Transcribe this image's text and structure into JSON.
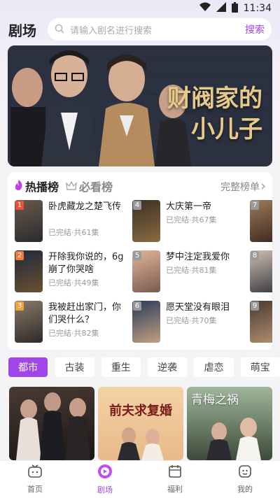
{
  "status_bar": {
    "time": "11:34"
  },
  "header": {
    "title": "剧场",
    "search_placeholder": "请输入剧名进行搜索",
    "search_button": "搜索"
  },
  "banner": {
    "title_line1": "财阀家的",
    "title_line2": "小儿子"
  },
  "ranking": {
    "tabs": [
      {
        "label": "热播榜",
        "icon": "fire-icon",
        "active": true
      },
      {
        "label": "必看榜",
        "icon": "crown-icon",
        "active": false
      }
    ],
    "full_list_label": "完整榜单",
    "items": [
      {
        "rank": "1",
        "name": "卧虎藏龙之楚飞传",
        "status": "已完结·共61集"
      },
      {
        "rank": "2",
        "name": "开除我你说的，6g崩了你哭啥",
        "status": "已完结·共49集"
      },
      {
        "rank": "3",
        "name": "我被赶出家门，你们哭什么？",
        "status": "已完结·共82集"
      },
      {
        "rank": "4",
        "name": "大庆第一帝",
        "status": "已完结·共67集"
      },
      {
        "rank": "5",
        "name": "梦中注定我爱你",
        "status": "已完结·共81集"
      },
      {
        "rank": "6",
        "name": "愿天堂没有眼泪",
        "status": "已完结·共70集"
      },
      {
        "rank": "7",
        "name": "",
        "status": ""
      },
      {
        "rank": "8",
        "name": "",
        "status": ""
      },
      {
        "rank": "9",
        "name": "",
        "status": ""
      }
    ]
  },
  "genres": [
    "都市",
    "古装",
    "重生",
    "逆袭",
    "虐恋",
    "萌宝"
  ],
  "posters": [
    {
      "title": ""
    },
    {
      "title": "前夫求复婚"
    },
    {
      "title": "青梅之祸"
    }
  ],
  "nav": [
    {
      "label": "首页",
      "icon": "tv-icon",
      "active": false
    },
    {
      "label": "剧场",
      "icon": "play-icon",
      "active": true
    },
    {
      "label": "福利",
      "icon": "calendar-icon",
      "active": false
    },
    {
      "label": "我的",
      "icon": "profile-icon",
      "active": false
    }
  ],
  "colors": {
    "accent": "#a046e8",
    "rank_colors": [
      "#e8523a",
      "#f07a3c",
      "#f0a43c",
      "#9a9a9a",
      "#9a9a9a",
      "#9a9a9a",
      "#9a9a9a",
      "#9a9a9a",
      "#9a9a9a"
    ]
  }
}
